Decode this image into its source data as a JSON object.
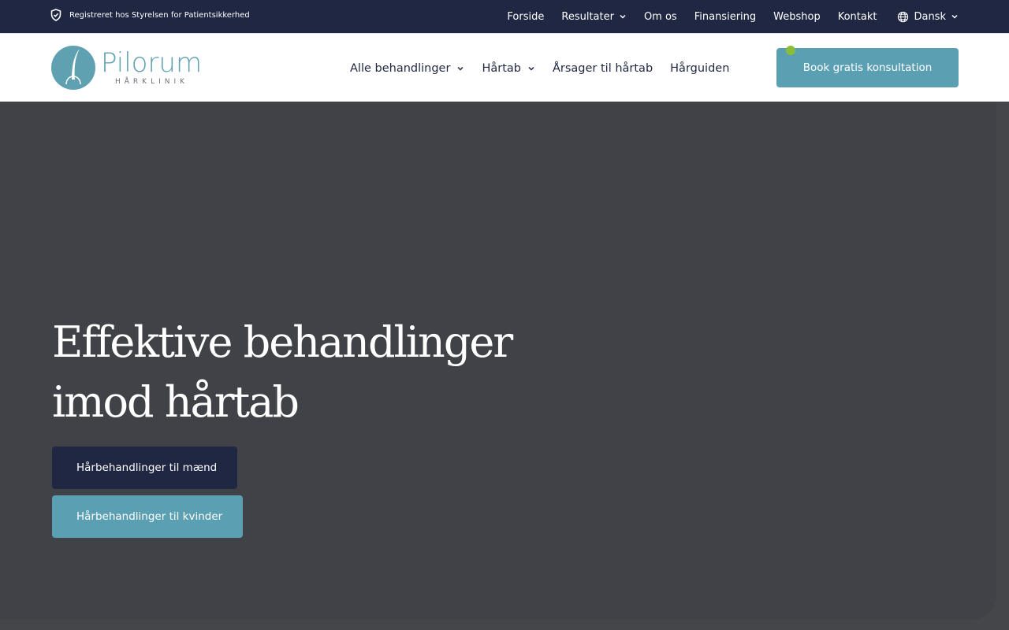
{
  "topbar": {
    "registration_text": "Registreret hos Styrelsen for Patientsikkerhed",
    "nav": [
      {
        "label": "Forside"
      },
      {
        "label": "Resultater"
      },
      {
        "label": "Om os"
      },
      {
        "label": "Finansiering"
      },
      {
        "label": "Webshop"
      },
      {
        "label": "Kontakt"
      }
    ],
    "language": "Dansk"
  },
  "header": {
    "logo_name": "Pilorum",
    "logo_sub": "HÅRKLINIK",
    "nav": [
      {
        "label": "Alle behandlinger"
      },
      {
        "label": "Hårtab"
      },
      {
        "label": "Årsager til hårtab"
      },
      {
        "label": "Hårguiden"
      }
    ],
    "cta_label": "Book gratis konsultation"
  },
  "hero": {
    "title_line1": "Effektive behandlinger",
    "title_line2": "imod hårtab",
    "button_men": "Hårbehandlinger til mænd",
    "button_women": "Hårbehandlinger til kvinder"
  },
  "colors": {
    "navy": "#1f2742",
    "teal": "#5b9fb3",
    "hero_bg": "#404247",
    "status_dot": "#8bbd3a"
  }
}
